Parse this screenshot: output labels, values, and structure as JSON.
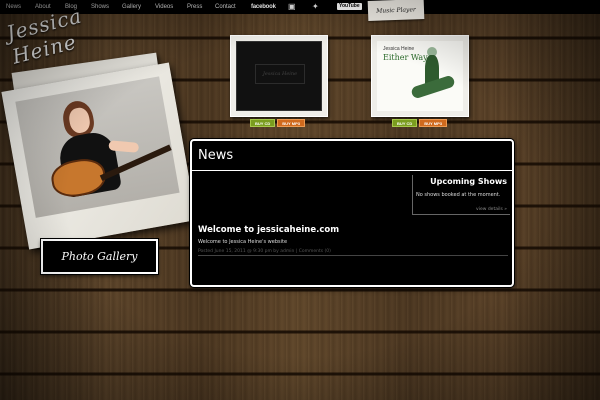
{
  "nav": {
    "items": [
      {
        "label": "News"
      },
      {
        "label": "About"
      },
      {
        "label": "Blog"
      },
      {
        "label": "Shows"
      },
      {
        "label": "Gallery"
      },
      {
        "label": "Videos"
      },
      {
        "label": "Press"
      },
      {
        "label": "Contact"
      }
    ],
    "social": {
      "facebook": "facebook",
      "myspace_icon": "myspace-icon",
      "twitter_icon": "twitter-icon",
      "youtube": "YouTube"
    },
    "music_player": "Music Player"
  },
  "artist": {
    "name": "Jessica Heine"
  },
  "photo_gallery_button": "Photo Gallery",
  "albums": [
    {
      "cover_text": "Jessica Heine",
      "buy_cd": "BUY CD",
      "buy_mp3": "BUY MP3"
    },
    {
      "artist": "Jessica Heine",
      "title": "Either Way",
      "buy_cd": "BUY CD",
      "buy_mp3": "BUY MP3"
    }
  ],
  "news": {
    "heading": "News",
    "upcoming_shows": {
      "title": "Upcoming Shows",
      "empty_text": "No shows booked at the moment.",
      "view_link": "view details »"
    },
    "post": {
      "title": "Welcome to jessicaheine.com",
      "body": "Welcome to Jessica Heine's website",
      "meta": "Posted June 15, 2011 @ 9:30 pm by admin | Comments (0)"
    }
  },
  "colors": {
    "buy_cd": "#7a9d1f",
    "buy_mp3": "#d06a1e",
    "panel_bg": "#000000",
    "album_title": "#2a6a2a"
  }
}
